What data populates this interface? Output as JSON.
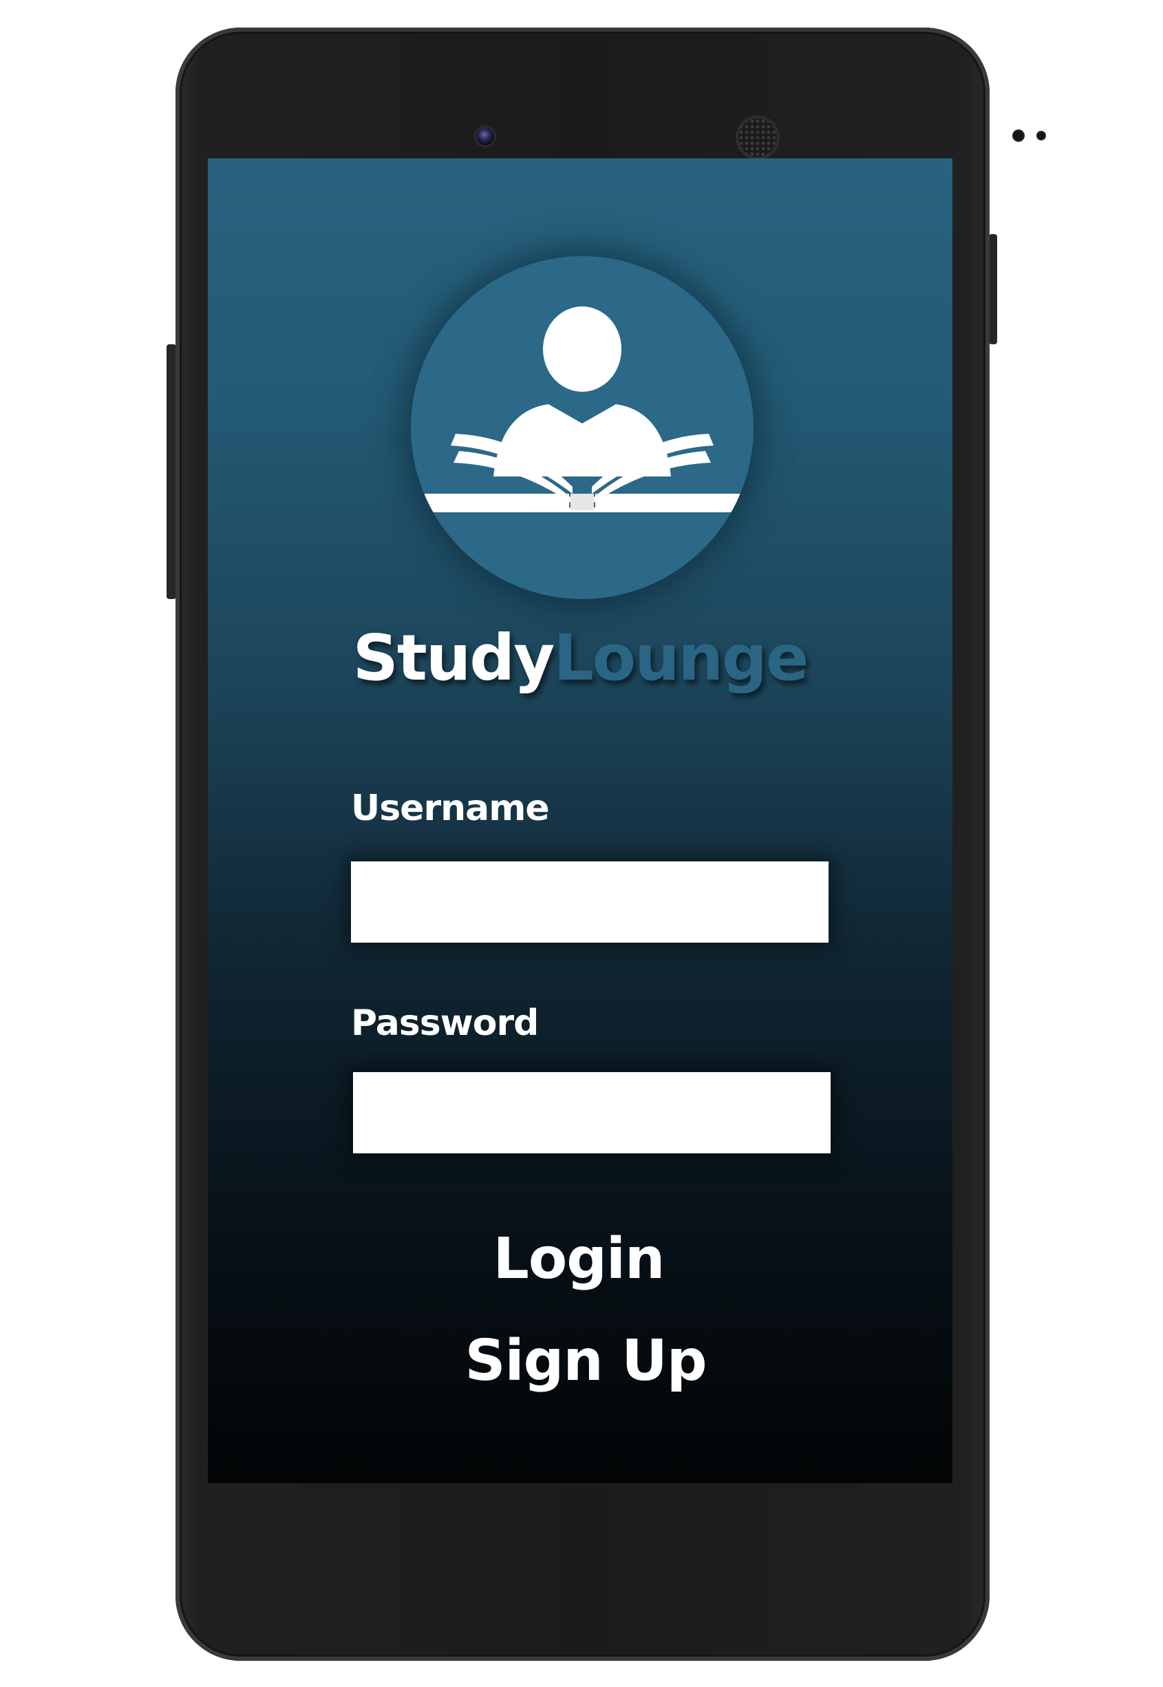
{
  "app": {
    "title_part1": "Study",
    "title_part2": "Lounge"
  },
  "form": {
    "username_label": "Username",
    "username_value": "",
    "password_label": "Password",
    "password_value": ""
  },
  "actions": {
    "login_label": "Login",
    "signup_label": "Sign Up"
  },
  "colors": {
    "accent": "#2c6888",
    "background_top": "#28627e",
    "background_bottom": "#020405",
    "text": "#ffffff"
  },
  "icons": {
    "logo": "person-reading-book-icon"
  }
}
